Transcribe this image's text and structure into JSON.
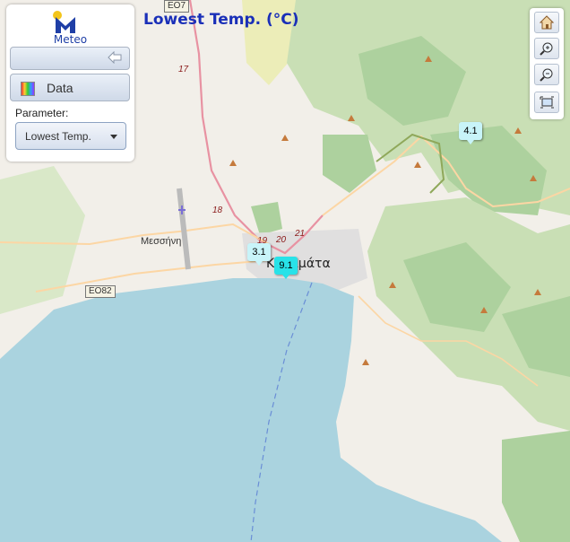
{
  "header": {
    "title": "Lowest Temp. (°C)"
  },
  "panel": {
    "logo_text": "Meteo",
    "data_label": "Data",
    "parameter_label": "Parameter:",
    "parameter_value": "Lowest Temp."
  },
  "toolbar": {
    "icons": [
      "home-icon",
      "zoom-in-icon",
      "zoom-out-icon",
      "zoom-extent-icon"
    ]
  },
  "markers": [
    {
      "value": "4.1",
      "color": "#c8f4f9"
    },
    {
      "value": "3.1",
      "color": "#c8f4f9"
    },
    {
      "value": "9.1",
      "color": "#28e2e8"
    }
  ],
  "map": {
    "places": [
      "Μεσσήνη",
      "Καλαμάτα"
    ],
    "road_numbers": [
      "17",
      "18",
      "19",
      "20",
      "21"
    ],
    "shields": [
      "EO7",
      "EO82"
    ],
    "colors": {
      "sea": "#aad3df",
      "land": "#f2efe9",
      "forest": "#add19e",
      "motorway": "#e892a2",
      "primary": "#fcd6a4"
    }
  }
}
